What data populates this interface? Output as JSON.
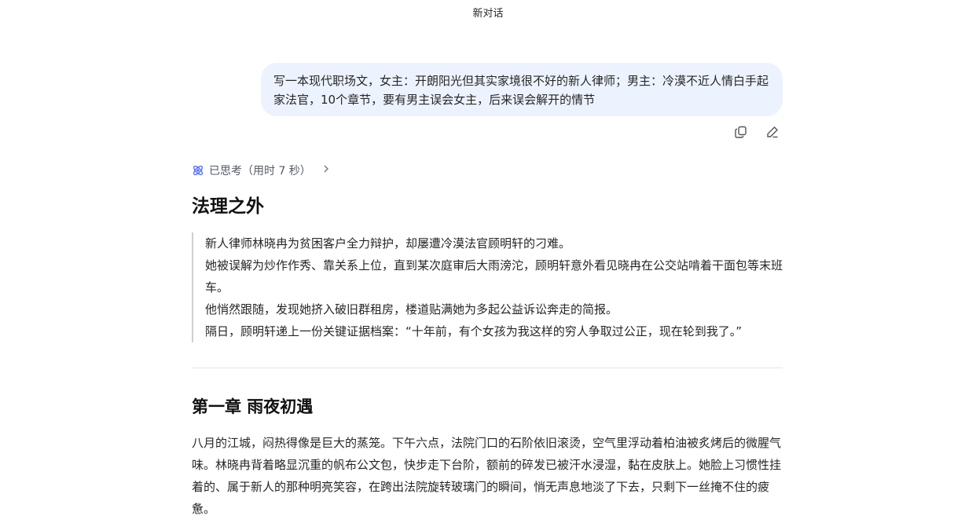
{
  "header": {
    "title": "新对话"
  },
  "user_message": {
    "text": "写一本现代职场文，女主：开朗阳光但其实家境很不好的新人律师；男主：冷漠不近人情白手起家法官，10个章节，要有男主误会女主，后来误会解开的情节",
    "actions": [
      "copy-icon",
      "edit-icon"
    ]
  },
  "thinking": {
    "label": "已思考（用时 7 秒）",
    "icon": "thinking-atom-icon",
    "accent": "#4d6bfe"
  },
  "response": {
    "title": "法理之外",
    "synopsis": [
      "新人律师林晓冉为贫困客户全力辩护，却屡遭冷漠法官顾明轩的刁难。",
      "她被误解为炒作作秀、靠关系上位，直到某次庭审后大雨滂沱，顾明轩意外看见晓冉在公交站啃着干面包等末班车。",
      "他悄然跟随，发现她挤入破旧群租房，楼道贴满她为多起公益诉讼奔走的简报。",
      "隔日，顾明轩递上一份关键证据档案：“十年前，有个女孩为我这样的穷人争取过公正，现在轮到我了。”"
    ],
    "chapter_title": "第一章 雨夜初遇",
    "chapter_text": "八月的江城，闷热得像是巨大的蒸笼。下午六点，法院门口的石阶依旧滚烫，空气里浮动着柏油被炙烤后的微腥气味。林晓冉背着略显沉重的帆布公文包，快步走下台阶，额前的碎发已被汗水浸湿，黏在皮肤上。她脸上习惯性挂着的、属于新人的那种明亮笑容，在跨出法院旋转玻璃门的瞬间，悄无声息地淡了下去，只剩下一丝掩不住的疲惫。"
  }
}
